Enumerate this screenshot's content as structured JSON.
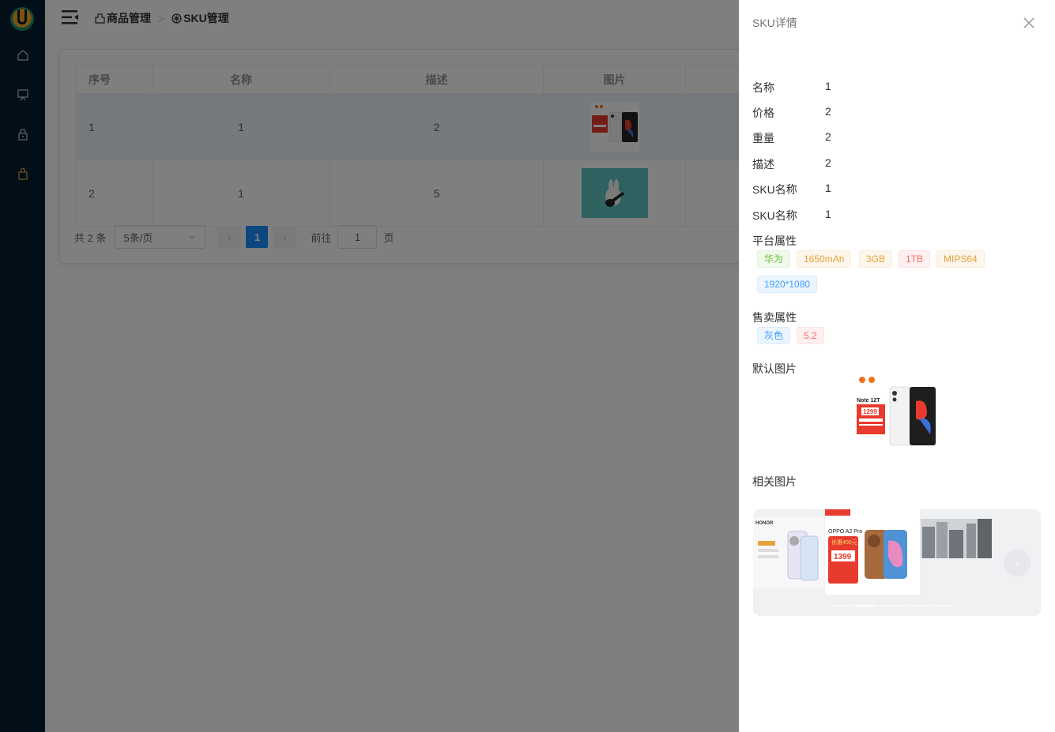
{
  "sidebar": {
    "items": [
      {
        "icon": "home-icon"
      },
      {
        "icon": "monitor-icon"
      },
      {
        "icon": "lock-icon"
      },
      {
        "icon": "bag-icon",
        "active": true
      }
    ],
    "active_color": "#e6a23c"
  },
  "header": {
    "breadcrumb": [
      "商品管理",
      "SKU管理"
    ]
  },
  "table": {
    "columns": [
      "序号",
      "名称",
      "描述",
      "图片"
    ],
    "rows": [
      {
        "index": "1",
        "name": "1",
        "desc": "2"
      },
      {
        "index": "2",
        "name": "1",
        "desc": "5"
      }
    ]
  },
  "pager": {
    "total": "共 2 条",
    "page_size": "5条/页",
    "current_page": "1",
    "goto_label": "前往",
    "goto_value": "1",
    "page_suffix": "页"
  },
  "drawer": {
    "title": "SKU详情",
    "fields": [
      {
        "label": "名称",
        "value": "1"
      },
      {
        "label": "价格",
        "value": "2"
      },
      {
        "label": "重量",
        "value": "2"
      },
      {
        "label": "描述",
        "value": "2"
      },
      {
        "label": "SKU名称",
        "value": "1"
      },
      {
        "label": "SKU名称",
        "value": "1"
      }
    ],
    "platform_attr_label": "平台属性",
    "platform_attrs": [
      "华为",
      "1650mAh",
      "3GB",
      "1TB",
      "MIPS64",
      "1920*1080"
    ],
    "sale_attr_label": "售卖属性",
    "sale_attrs": [
      "灰色",
      "5.2"
    ],
    "default_image_label": "默认图片",
    "related_images_label": "相关图片",
    "product_image_text": {
      "model": "Note 12T",
      "price": "1299"
    },
    "carousel": {
      "brand1": "HONOR",
      "brand2_model": "OPPO A2 Pro",
      "brand2_discount": "优惠400元",
      "brand2_price": "1399"
    }
  }
}
